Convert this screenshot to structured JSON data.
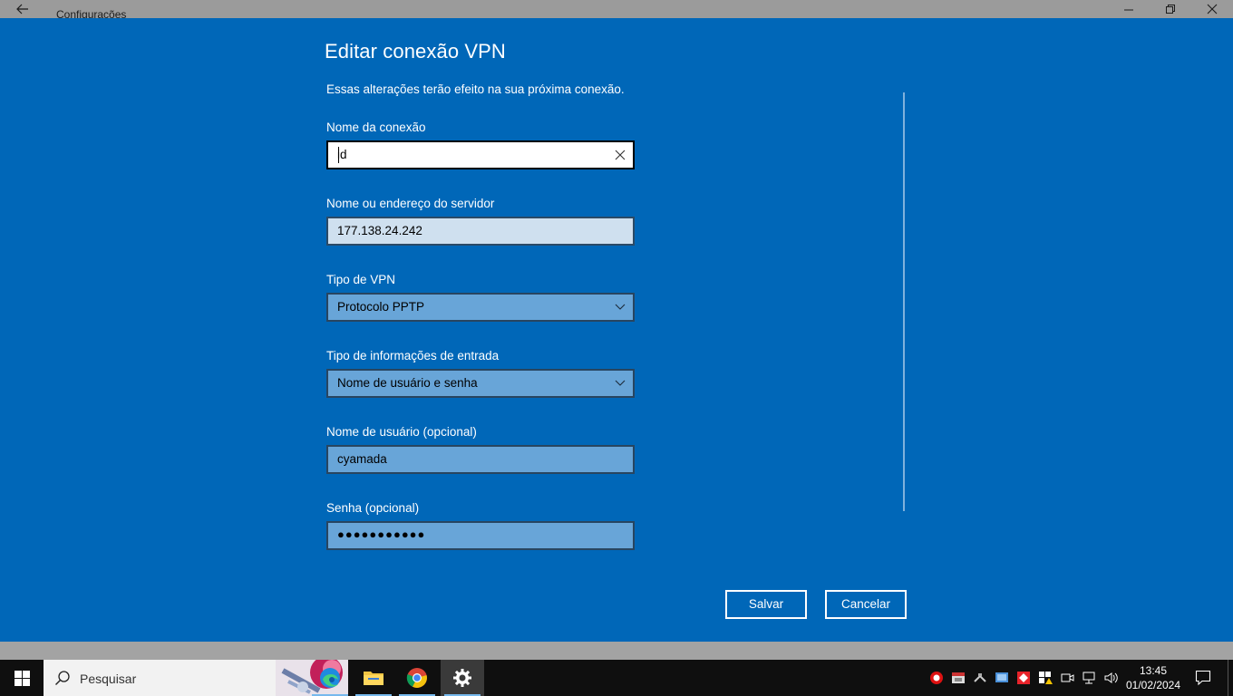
{
  "window": {
    "title": "Configurações"
  },
  "dialog": {
    "title": "Editar conexão VPN",
    "subtitle": "Essas alterações terão efeito na sua próxima conexão.",
    "fields": {
      "connection_name": {
        "label": "Nome da conexão",
        "value": "id"
      },
      "server": {
        "label": "Nome ou endereço do servidor",
        "value": "177.138.24.242"
      },
      "vpn_type": {
        "label": "Tipo de VPN",
        "value": "Protocolo PPTP"
      },
      "signin_type": {
        "label": "Tipo de informações de entrada",
        "value": "Nome de usuário e senha"
      },
      "username": {
        "label": "Nome de usuário (opcional)",
        "value": "cyamada"
      },
      "password": {
        "label": "Senha (opcional)",
        "value": "●●●●●●●●●●●"
      }
    },
    "buttons": {
      "save": "Salvar",
      "cancel": "Cancelar"
    },
    "colors": {
      "background": "#0067b8",
      "text": "#ffffff"
    }
  },
  "taskbar": {
    "search_placeholder": "Pesquisar",
    "apps": [
      "edge-icon",
      "file-explorer-icon",
      "chrome-icon",
      "settings-gear-icon"
    ],
    "clock": {
      "time": "13:45",
      "date": "01/02/2024"
    }
  }
}
